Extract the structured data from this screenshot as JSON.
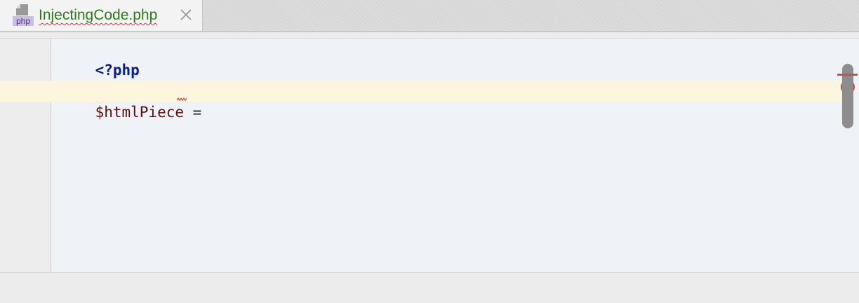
{
  "tab": {
    "filename": "InjectingCode.php",
    "file_type_badge": "php",
    "file_icon": "php-file-icon",
    "close_icon": "close-icon",
    "label_color": "#2c7a18"
  },
  "editor": {
    "lines": [
      {
        "text": "<?php"
      },
      {
        "text": ""
      },
      {
        "variable": "$htmlPiece",
        "operator": " ="
      }
    ],
    "error_indicator_icon": "error-icon",
    "colors": {
      "background": "#eff3f8",
      "caret_row": "#fbf6dd",
      "keyword": "#0a1f8a",
      "variable": "#5a0f0f",
      "error": "#d34045"
    }
  }
}
